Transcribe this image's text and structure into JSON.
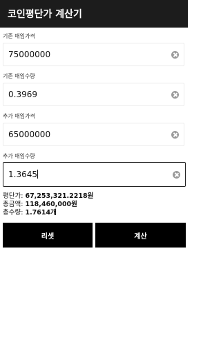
{
  "appbar": {
    "title": "코인평단가 계산기"
  },
  "form": {
    "fields": [
      {
        "label": "기존 매입가격",
        "value": "75000000"
      },
      {
        "label": "기존 매입수량",
        "value": "0.3969"
      },
      {
        "label": "추가 매입가격",
        "value": "65000000"
      },
      {
        "label": "추가 매입수량",
        "value": "1.3645"
      }
    ]
  },
  "results": {
    "avg_label": "평단가: ",
    "avg_value": "67,253,321.2218원",
    "total_label": "총금액: ",
    "total_value": "118,460,000원",
    "qty_label": "총수량: ",
    "qty_value": "1.7614개"
  },
  "buttons": {
    "reset_label": "리셋",
    "calc_label": "계산"
  },
  "colors": {
    "appbar": "#1c1c1c",
    "button": "#000000",
    "clear_icon": "#9a9a9a"
  }
}
